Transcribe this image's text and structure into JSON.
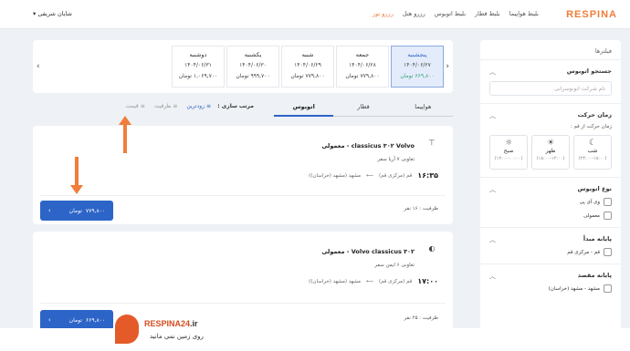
{
  "header": {
    "logo": "RESPINA",
    "nav": [
      "بلیط هواپیما",
      "بلیط قطار",
      "بلیط اتوبوس",
      "رزرو هتل",
      "رزرو تور"
    ],
    "nav_active_index": 4,
    "user": "شایان شریفی"
  },
  "dates": [
    {
      "day": "پنجشنبه",
      "date": "۱۴۰۴/۰۶/۲۷",
      "price": "۶۶۹,۸۰۰ تومان",
      "active": true
    },
    {
      "day": "جمعه",
      "date": "۱۴۰۴/۰۶/۲۸",
      "price": "۷۷۹,۸۰۰ تومان"
    },
    {
      "day": "شنبه",
      "date": "۱۴۰۴/۰۶/۲۹",
      "price": "۷۷۹,۸۰۰ تومان"
    },
    {
      "day": "یکشنبه",
      "date": "۱۴۰۴/۰۶/۳۰",
      "price": "۹۹۹,۷۰۰ تومان"
    },
    {
      "day": "دوشنبه",
      "date": "۱۴۰۴/۰۶/۳۱",
      "price": "۱,۰۶۹,۷۰۰ تومان"
    }
  ],
  "tabs": [
    "هواپیما",
    "قطار",
    "اتوبوس"
  ],
  "active_tab": 2,
  "sort": {
    "label": "مرتب سازی :",
    "options": [
      "زودترین",
      "ظرفیت",
      "قیمت"
    ],
    "active": 0
  },
  "sidebar": {
    "title": "فیلترها",
    "search_title": "جستجو اتوبوس",
    "search_placeholder": "نام شرکت اتوبوسرانی",
    "time_title": "زمان حرکت",
    "time_sub": "زمان حرکت از قم :",
    "times": [
      {
        "name": "شب",
        "range": "(۲۴:۰۰-۱۸:۰۰)",
        "icon": "☾"
      },
      {
        "name": "ظهر",
        "range": "(۱۸:۰۰-۱۲:۰۰)",
        "icon": "☀"
      },
      {
        "name": "صبح",
        "range": "(۱۲:۰۰-۰۰:۰۰)",
        "icon": "☼"
      }
    ],
    "bus_type_title": "نوع اتوبوس",
    "bus_types": [
      "وی آی پی",
      "معمولی"
    ],
    "origin_title": "پایانه مبدأ",
    "origins": [
      "قم - مرکزی قم"
    ],
    "dest_title": "پایانه مقصد",
    "dests": [
      "مشهد - مشهد (خراسان)"
    ]
  },
  "cards": [
    {
      "name": "classicus ۳۰۲ Volvo - معمولی",
      "coop": "تعاونی ۷ آریا سفر",
      "time": "۱۶:۳۵",
      "origin": "قم (مرکزی قم)",
      "dest": "مشهد (مشهد (خراسان))",
      "capacity": "ظرفیت : ۱۶ نفر",
      "price": "۷۷۹,۸۰۰",
      "currency": "تومان"
    },
    {
      "name": "Volvo classicus ۳۰۲ - معمولی",
      "coop": "تعاونی ۶ ایمن سفر",
      "time": "۱۷:۰۰",
      "origin": "قم (مرکزی قم)",
      "dest": "مشهد (مشهد (خراسان))",
      "capacity": "ظرفیت : ۲۵ نفر",
      "price": "۶۶۹,۸۰۰",
      "currency": "تومان"
    }
  ],
  "footer": {
    "brand": "RESPINA24",
    "tld": ".ir",
    "slogan": "روی زمین نمی مانید"
  },
  "colors": {
    "accent": "#f07d3a",
    "primary": "#2d64c8"
  }
}
